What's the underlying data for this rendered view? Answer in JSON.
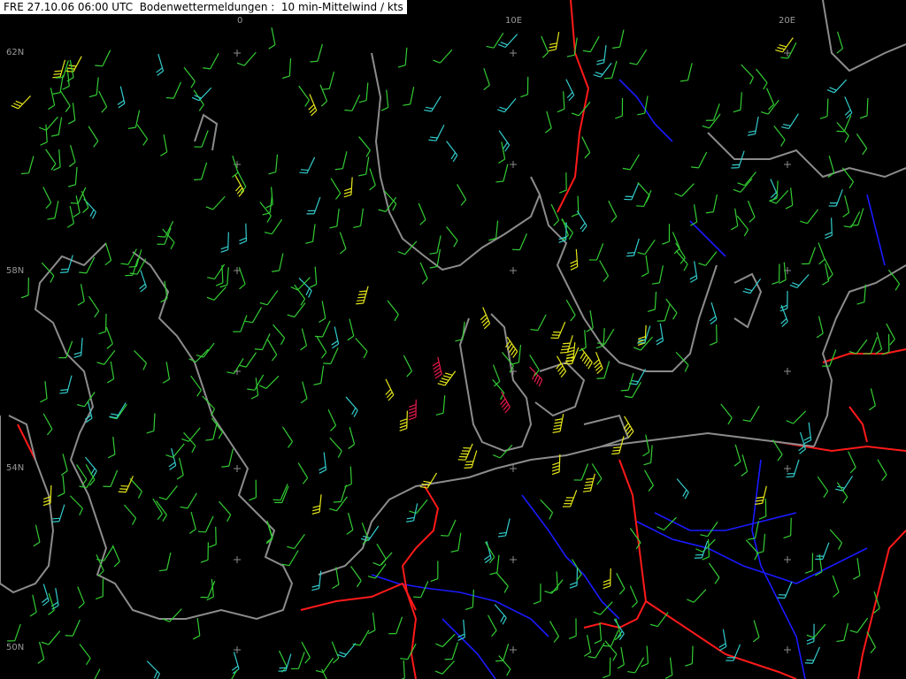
{
  "title": "FRE 27.10.06 06:00 UTC  Bodenwettermeldungen :  10 min-Mittelwind / kts",
  "grid_labels": {
    "lon_0": "0",
    "lon_10e": "10E",
    "lon_20e": "20E",
    "lat_62n": "62N",
    "lat_58n": "58N",
    "lat_54n": "54N",
    "lat_50n": "50N"
  },
  "colors": {
    "background": "#000000",
    "coastline": "#8c8c8c",
    "border": "#ff1a1a",
    "river": "#1a1aff",
    "grid": "#8c8c8c",
    "wind_light": "#33cc33",
    "wind_moderate": "#33cccc",
    "wind_strong": "#e6e61a",
    "wind_gale": "#e6194b"
  }
}
